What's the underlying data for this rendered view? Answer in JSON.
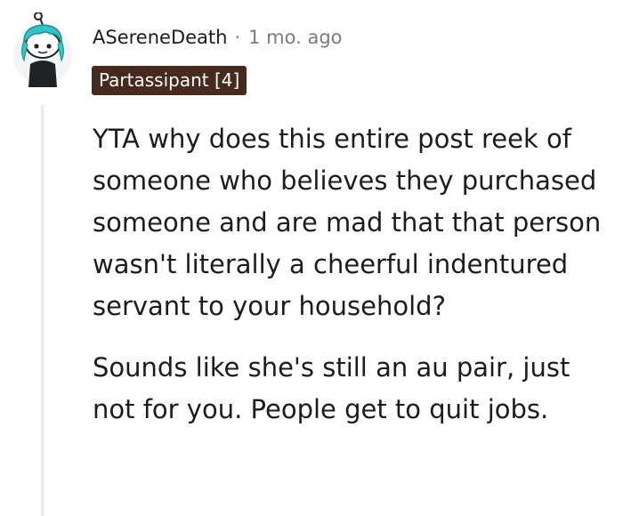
{
  "comment": {
    "author": "ASereneDeath",
    "separator": "·",
    "timestamp": "1 mo. ago",
    "flair": "Partassipant [4]",
    "paragraphs": [
      "YTA why does this entire post reek of someone who believes they purchased someone and are mad that that person wasn't literally a cheerful indentured servant to your household?",
      "Sounds like she's still an au pair, just not for you. People get to quit jobs."
    ]
  },
  "colors": {
    "flair_background": "#472a1e",
    "flair_text": "#ffffff",
    "avatar_hair": "#2fc6c8",
    "thread_line": "#e6e8ea"
  },
  "icons": {
    "avatar": "snoo-avatar-icon"
  }
}
